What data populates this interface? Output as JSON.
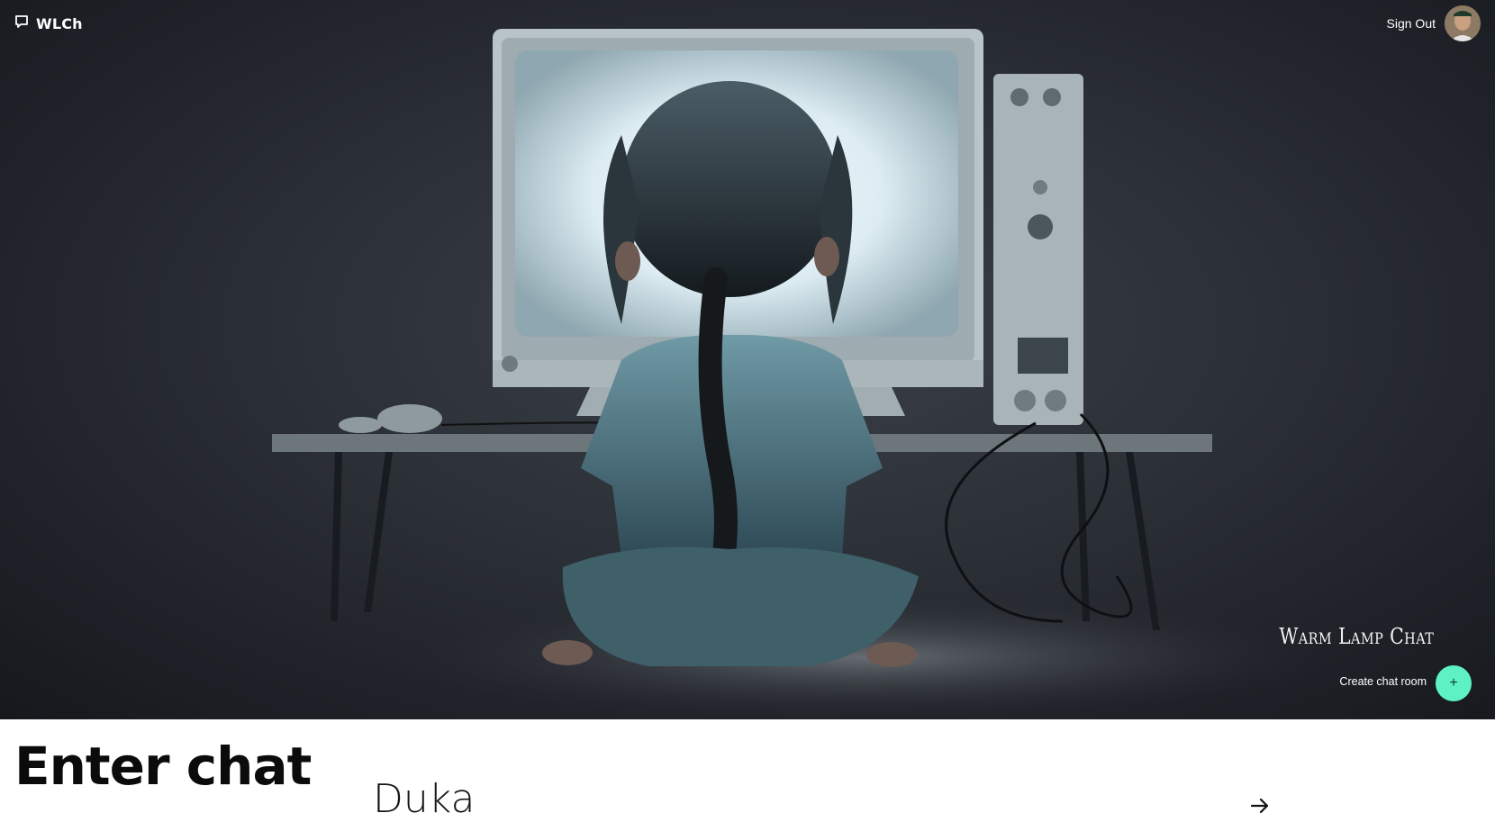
{
  "header": {
    "brand_label": "WLCh",
    "brand_icon": "chat-bubble-icon",
    "signout_label": "Sign Out",
    "avatar_icon": "user-avatar"
  },
  "hero": {
    "image_desc_icon": "hero-illustration",
    "brand_script": "Warm Lamp Chat",
    "create_label": "Create chat room",
    "create_button_symbol": "+",
    "accent_color": "#5ef2c3"
  },
  "main": {
    "title": "Enter chat",
    "rooms": [
      {
        "name": "Duka",
        "arrow_icon": "arrow-right-icon"
      }
    ]
  }
}
